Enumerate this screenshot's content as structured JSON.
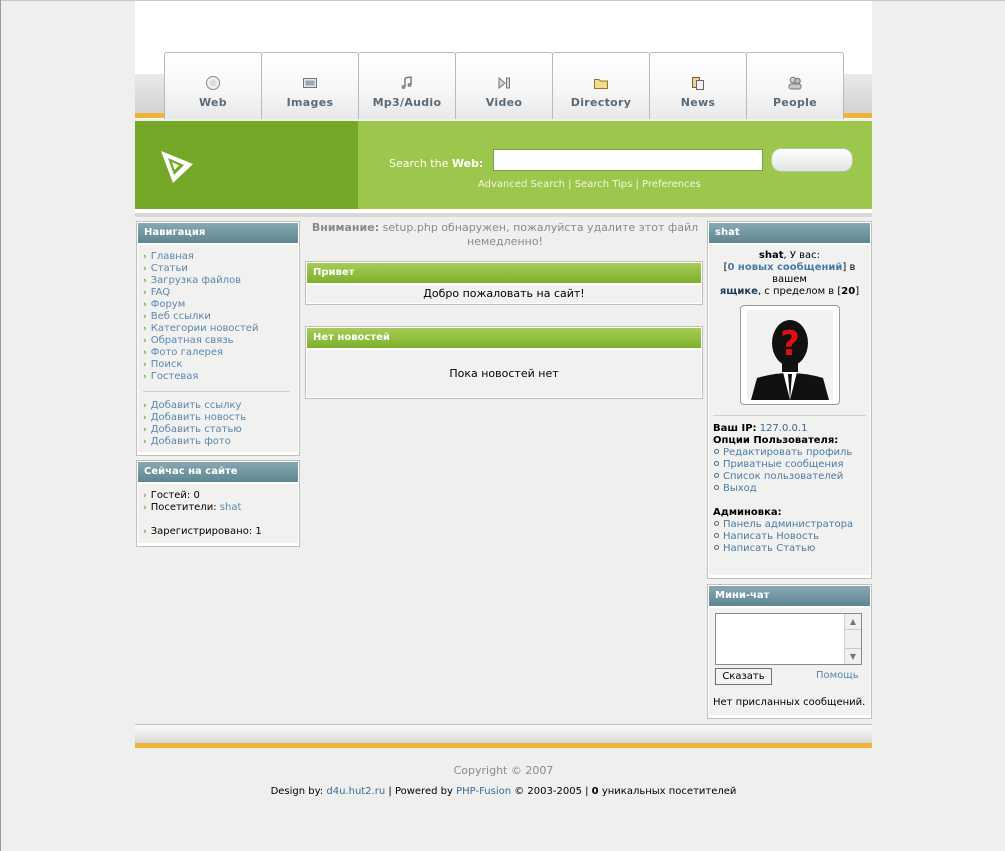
{
  "tabs": [
    {
      "label": "Web",
      "icon": "globe-icon"
    },
    {
      "label": "Images",
      "icon": "image-icon"
    },
    {
      "label": "Mp3/Audio",
      "icon": "music-note-icon"
    },
    {
      "label": "Video",
      "icon": "play-icon"
    },
    {
      "label": "Directory",
      "icon": "folder-icon"
    },
    {
      "label": "News",
      "icon": "newspaper-icon"
    },
    {
      "label": "People",
      "icon": "people-icon"
    }
  ],
  "search": {
    "label_prefix": "Search the ",
    "label_bold": "Web:",
    "value": "",
    "links": [
      "Advanced Search",
      "Search Tips",
      "Preferences"
    ]
  },
  "colors": {
    "green": "#9dc64c",
    "dark_green": "#76a827",
    "orange": "#f2b23a",
    "panel_head": "#6f95a0"
  },
  "nav": {
    "title": "Навигация",
    "items": [
      "Главная",
      "Статьи",
      "Загрузка файлов",
      "FAQ",
      "Форум",
      "Веб ссылки",
      "Категории новостей",
      "Обратная связь",
      "Фото галерея",
      "Поиск",
      "Гостевая"
    ],
    "items2": [
      "Добавить ссылку",
      "Добавить новость",
      "Добавить статью",
      "Добавить фото"
    ]
  },
  "online": {
    "title": "Сейчас на сайте",
    "guests": "Гостей: 0",
    "visitors_label": "Посетители:",
    "visitors_user": "shat",
    "registered": "Зарегистрировано: 1"
  },
  "notice": {
    "label": "Внимание:",
    "text": "setup.php обнаружен, пожалуйста удалите этот файл немедленно!"
  },
  "welcome": {
    "title": "Привет",
    "text": "Добро пожаловать на сайт!"
  },
  "news": {
    "title": "Нет новостей",
    "text": "Пока новостей нет"
  },
  "user": {
    "title": "shat",
    "name": "shat",
    "greet": ", У вас:",
    "bracket_open": "[",
    "messages": "0 новых сообщений",
    "bracket_close": "]",
    "in": " в вашем",
    "box": "ящике",
    "limit_text": ", с пределом в [",
    "limit": "20",
    "limit_close": "]",
    "ip_label": "Ваш IP:",
    "ip": "127.0.0.1",
    "options_title": "Опции Пользователя:",
    "options": [
      "Редактировать профиль",
      "Приватные сообщения",
      "Список пользователей",
      "Выход"
    ],
    "admin_title": "Админовка:",
    "admin": [
      "Панель администратора",
      "Написать Новость",
      "Написать Статью"
    ]
  },
  "chat": {
    "title": "Мини-чат",
    "send": "Сказать",
    "help": "Помощь",
    "empty": "Нет присланных сообщений."
  },
  "footer": {
    "copyright": "Copyright © 2007",
    "design_label": "Design by:",
    "design_link": "d4u.hut2.ru",
    "powered_label": "Powered by",
    "powered_link": "PHP-Fusion",
    "years": "© 2003-2005",
    "count": "0",
    "unique": "уникальных посетителей"
  }
}
